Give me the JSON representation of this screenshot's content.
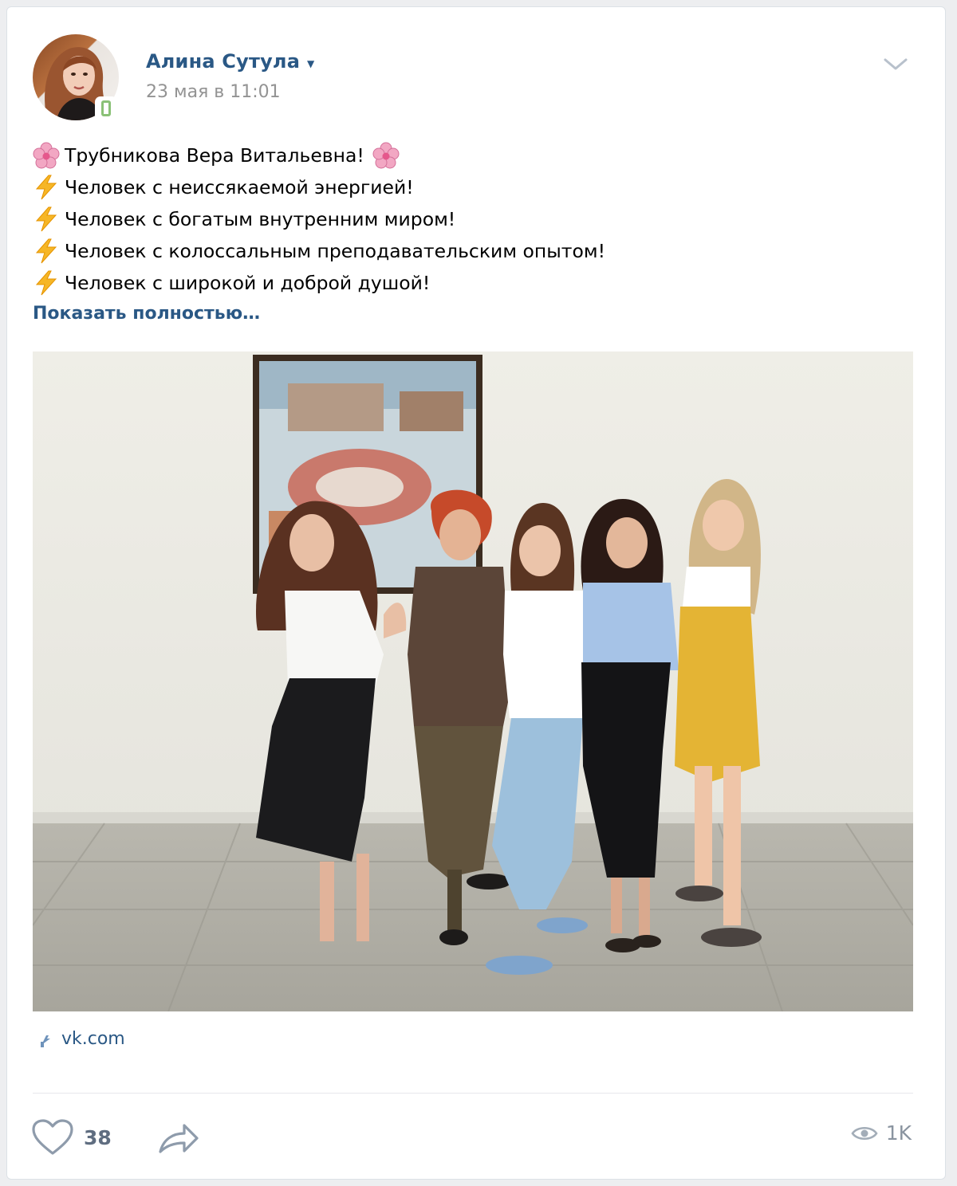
{
  "post": {
    "author": "Алина Сутула",
    "date": "23 мая в 11:01",
    "lines": [
      {
        "prefix_icon": "flower-emoji",
        "text": "Трубникова Вера Витальевна!",
        "suffix_icon": "flower-emoji"
      },
      {
        "prefix_icon": "lightning-emoji",
        "text": "Человек с неиссякаемой энергией!"
      },
      {
        "prefix_icon": "lightning-emoji",
        "text": "Человек с богатым внутренним миром!"
      },
      {
        "prefix_icon": "lightning-emoji",
        "text": "Человек с колоссальным преподавательским опытом!"
      },
      {
        "prefix_icon": "lightning-emoji",
        "text": "Человек с широкой и доброй душой!"
      }
    ],
    "show_more": "Показать полностью…",
    "source": "vk.com"
  },
  "footer": {
    "likes": "38",
    "views": "1K"
  },
  "icons": {
    "like": "heart-icon",
    "share": "share-arrow-icon",
    "views": "eye-icon",
    "menu": "chevron-down-icon",
    "source": "link-icon",
    "online": "mobile-online-icon"
  },
  "colors": {
    "link": "#2a5885",
    "muted": "#939393",
    "background": "#edeef0",
    "card": "#ffffff",
    "online": "#8ac176"
  }
}
